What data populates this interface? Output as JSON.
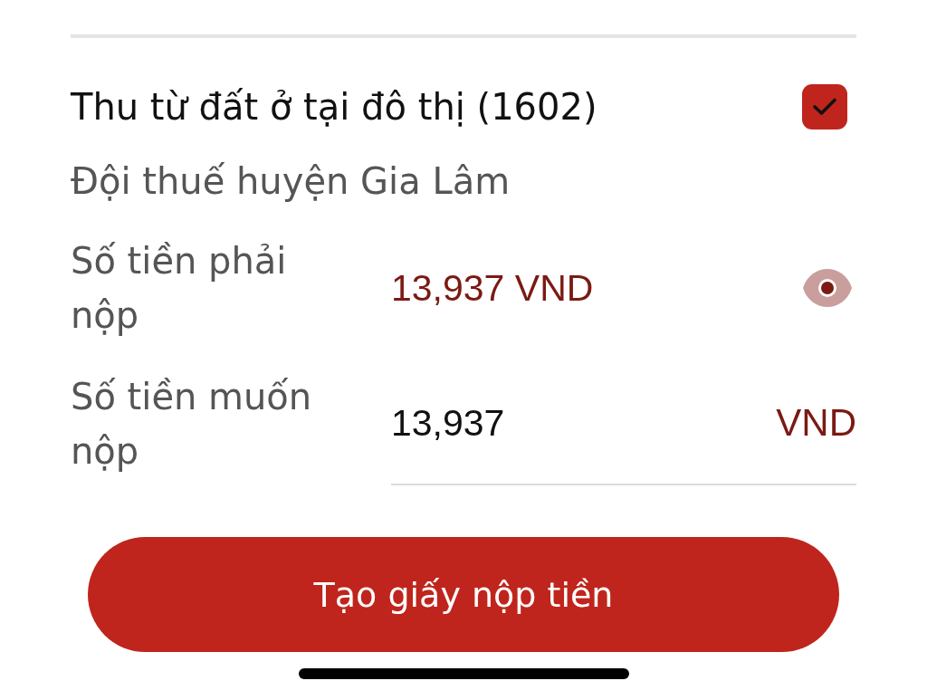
{
  "title": "Thu từ đất ở tại đô thị (1602)",
  "checked": true,
  "subtitle": "Đội thuế huyện Gia Lâm",
  "fields": [
    {
      "kind": "display",
      "label": "Số tiền phải nộp",
      "value": "13,937 VND"
    },
    {
      "kind": "input",
      "label": "Số tiền muốn nộp",
      "value": "13,937",
      "unit": "VND"
    }
  ],
  "button": "Tạo giấy nộp tiền"
}
